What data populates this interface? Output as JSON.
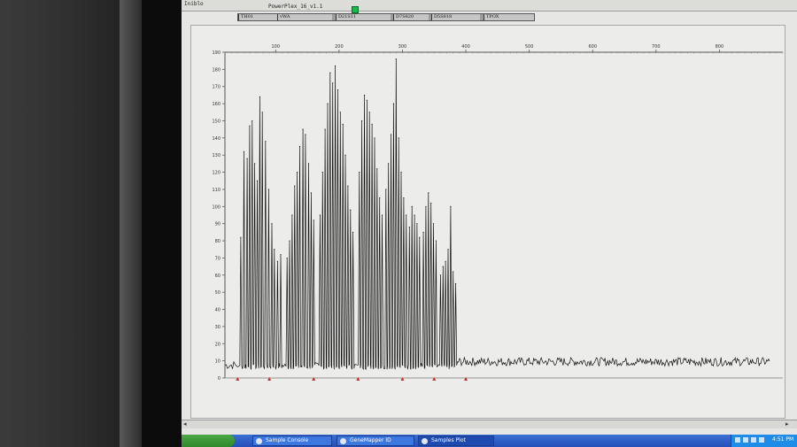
{
  "window": {
    "sample_name": "Iniblo",
    "run_name": "PowerPlex_16_v1.1"
  },
  "markers": [
    {
      "label": "TH01"
    },
    {
      "label": "vWA"
    },
    {
      "label": "D21S11"
    },
    {
      "label": "D7S820"
    },
    {
      "label": "D5S818"
    },
    {
      "label": "TPOX"
    }
  ],
  "chart_data": {
    "type": "line",
    "title": "",
    "xlabel": "",
    "ylabel": "",
    "xlim": [
      20,
      900
    ],
    "ylim": [
      0,
      190
    ],
    "x_ticks": [
      100,
      200,
      300,
      400,
      500,
      600,
      700,
      800
    ],
    "x_tick_labels": [
      "100",
      "200",
      "300",
      "400",
      "500",
      "600",
      "700",
      "800"
    ],
    "y_ticks": [
      0,
      10,
      20,
      30,
      40,
      50,
      60,
      70,
      80,
      90,
      100,
      110,
      120,
      130,
      140,
      150,
      160,
      170,
      180,
      190
    ],
    "y_tick_labels": [
      "0",
      "10",
      "20",
      "30",
      "40",
      "50",
      "60",
      "70",
      "80",
      "90",
      "100",
      "110",
      "120",
      "130",
      "140",
      "150",
      "160",
      "170",
      "180",
      "190"
    ],
    "grid": false,
    "baseline": 5,
    "peaks": [
      {
        "x": 45,
        "y": 82
      },
      {
        "x": 50,
        "y": 132
      },
      {
        "x": 55,
        "y": 128
      },
      {
        "x": 59,
        "y": 147
      },
      {
        "x": 63,
        "y": 150
      },
      {
        "x": 67,
        "y": 125
      },
      {
        "x": 71,
        "y": 115
      },
      {
        "x": 75,
        "y": 164
      },
      {
        "x": 79,
        "y": 155
      },
      {
        "x": 84,
        "y": 138
      },
      {
        "x": 89,
        "y": 110
      },
      {
        "x": 94,
        "y": 90
      },
      {
        "x": 98,
        "y": 75
      },
      {
        "x": 103,
        "y": 68
      },
      {
        "x": 108,
        "y": 72
      },
      {
        "x": 118,
        "y": 70
      },
      {
        "x": 122,
        "y": 80
      },
      {
        "x": 126,
        "y": 95
      },
      {
        "x": 130,
        "y": 112
      },
      {
        "x": 134,
        "y": 120
      },
      {
        "x": 138,
        "y": 135
      },
      {
        "x": 143,
        "y": 145
      },
      {
        "x": 147,
        "y": 142
      },
      {
        "x": 152,
        "y": 125
      },
      {
        "x": 156,
        "y": 108
      },
      {
        "x": 160,
        "y": 92
      },
      {
        "x": 170,
        "y": 95
      },
      {
        "x": 174,
        "y": 120
      },
      {
        "x": 178,
        "y": 145
      },
      {
        "x": 182,
        "y": 160
      },
      {
        "x": 186,
        "y": 178
      },
      {
        "x": 190,
        "y": 172
      },
      {
        "x": 194,
        "y": 182
      },
      {
        "x": 198,
        "y": 168
      },
      {
        "x": 202,
        "y": 155
      },
      {
        "x": 206,
        "y": 148
      },
      {
        "x": 210,
        "y": 130
      },
      {
        "x": 214,
        "y": 112
      },
      {
        "x": 218,
        "y": 98
      },
      {
        "x": 222,
        "y": 85
      },
      {
        "x": 232,
        "y": 120
      },
      {
        "x": 236,
        "y": 150
      },
      {
        "x": 240,
        "y": 165
      },
      {
        "x": 244,
        "y": 162
      },
      {
        "x": 248,
        "y": 155
      },
      {
        "x": 252,
        "y": 148
      },
      {
        "x": 256,
        "y": 140
      },
      {
        "x": 260,
        "y": 122
      },
      {
        "x": 264,
        "y": 105
      },
      {
        "x": 268,
        "y": 95
      },
      {
        "x": 274,
        "y": 110
      },
      {
        "x": 278,
        "y": 125
      },
      {
        "x": 282,
        "y": 142
      },
      {
        "x": 286,
        "y": 160
      },
      {
        "x": 290,
        "y": 186
      },
      {
        "x": 294,
        "y": 140
      },
      {
        "x": 298,
        "y": 120
      },
      {
        "x": 302,
        "y": 105
      },
      {
        "x": 306,
        "y": 95
      },
      {
        "x": 311,
        "y": 88
      },
      {
        "x": 315,
        "y": 100
      },
      {
        "x": 319,
        "y": 95
      },
      {
        "x": 323,
        "y": 90
      },
      {
        "x": 327,
        "y": 82
      },
      {
        "x": 333,
        "y": 85
      },
      {
        "x": 337,
        "y": 100
      },
      {
        "x": 341,
        "y": 108
      },
      {
        "x": 345,
        "y": 102
      },
      {
        "x": 349,
        "y": 90
      },
      {
        "x": 353,
        "y": 80
      },
      {
        "x": 360,
        "y": 60
      },
      {
        "x": 364,
        "y": 65
      },
      {
        "x": 368,
        "y": 68
      },
      {
        "x": 372,
        "y": 75
      },
      {
        "x": 376,
        "y": 100
      },
      {
        "x": 380,
        "y": 62
      },
      {
        "x": 384,
        "y": 55
      }
    ],
    "noise_region": [
      400,
      880
    ]
  },
  "scrollbar": {
    "left_arrow": "◂",
    "right_arrow": "▸"
  },
  "taskbar": {
    "tasks": [
      {
        "label": "Sample Console"
      },
      {
        "label": "GeneMapper ID"
      },
      {
        "label": "Samples Plot"
      }
    ],
    "clock": "4:51 PM"
  },
  "colors": {
    "trace": "#111111",
    "status_green": "#18b84a",
    "marker_bar": "#9c9c9c",
    "taskbar": "#2450b8",
    "peak_marker": "#c0302a"
  }
}
